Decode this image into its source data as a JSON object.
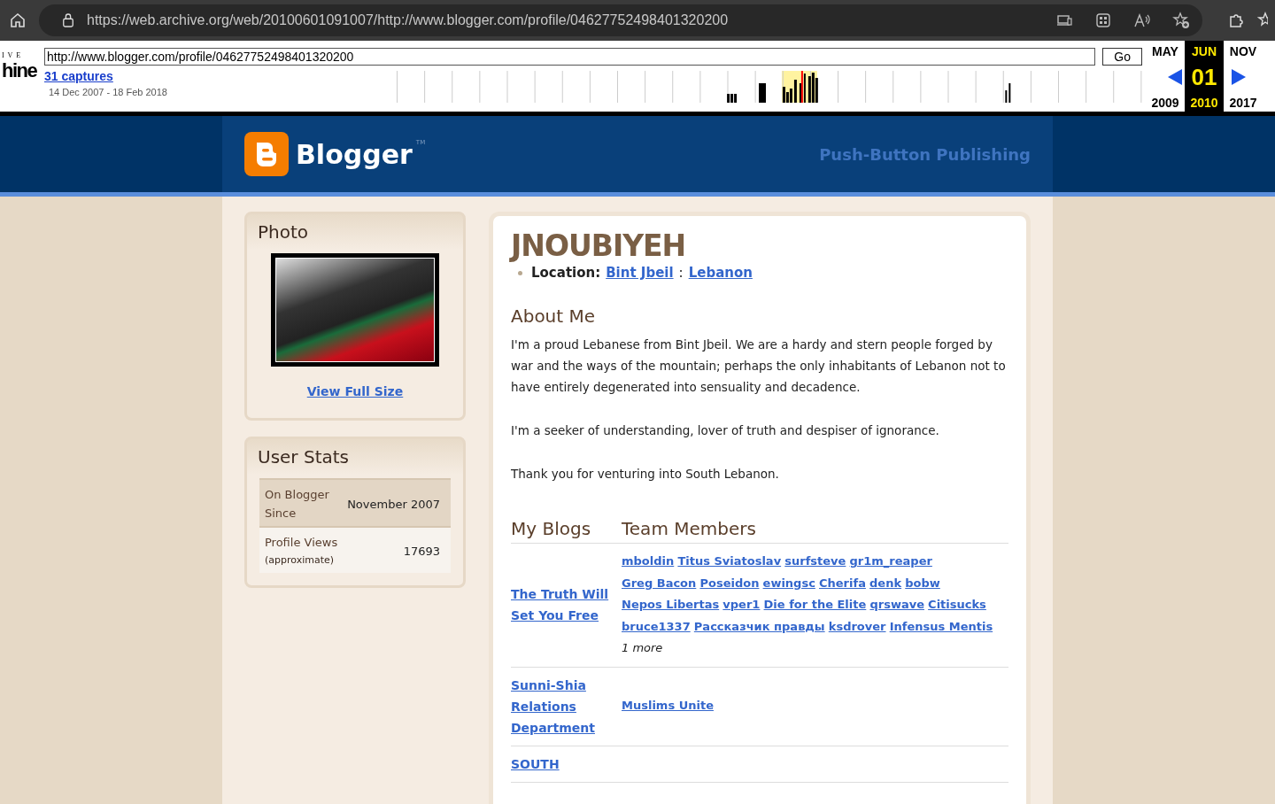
{
  "browser": {
    "url": "https://web.archive.org/web/20100601091007/http://www.blogger.com/profile/04627752498401320200"
  },
  "wayback": {
    "logo_top": "I V E",
    "logo_bottom": "hine",
    "url_value": "http://www.blogger.com/profile/04627752498401320200",
    "go_label": "Go",
    "captures": "31 captures",
    "date_range": "14 Dec 2007 - 18 Feb 2018",
    "months": [
      {
        "month": "MAY",
        "year": "2009",
        "selected": false
      },
      {
        "month": "JUN",
        "day": "01",
        "year": "2010",
        "selected": true
      },
      {
        "month": "NOV",
        "year": "2017",
        "selected": false
      }
    ]
  },
  "header": {
    "logo": "Blogger",
    "trademark": "TM",
    "tagline": "Push-Button Publishing"
  },
  "photo_panel": {
    "title": "Photo",
    "link": "View Full Size"
  },
  "stats_panel": {
    "title": "User Stats",
    "rows": [
      {
        "label": "On Blogger Since",
        "value": "November 2007"
      },
      {
        "label": "Profile Views",
        "note": "(approximate)",
        "value": "17693"
      }
    ]
  },
  "profile": {
    "name": "JNOUBIYEH",
    "location_label": "Location:",
    "location_links": [
      "Bint Jbeil",
      "Lebanon"
    ],
    "location_separator": ":",
    "about_title": "About Me",
    "about": [
      "I'm a proud Lebanese from Bint Jbeil. We are a hardy and stern people forged by war and the ways of the mountain; perhaps the only inhabitants of Lebanon not to have entirely degenerated into sensuality and decadence.",
      "I'm a seeker of understanding, lover of truth and despiser of ignorance.",
      "Thank you for venturing into South Lebanon."
    ],
    "blogs_heading": "My Blogs",
    "members_heading": "Team Members",
    "blogs": [
      {
        "title": "The Truth Will Set You Free",
        "members": [
          "mboldin",
          "Titus Sviatoslav",
          "surfsteve",
          "gr1m_reaper",
          "Greg Bacon",
          "Poseidon",
          "ewingsc",
          "Cherifa",
          "denk",
          "bobw",
          "Nepos Libertas",
          "vper1",
          "Die for the Elite",
          "qrswave",
          "Citisucks",
          "bruce1337",
          "Рассказчик правды",
          "ksdrover",
          "Infensus Mentis"
        ],
        "more": "1  more"
      },
      {
        "title": "Sunni-Shia Relations Department",
        "members": [
          "Muslims Unite"
        ]
      },
      {
        "title": "SOUTH"
      }
    ]
  }
}
